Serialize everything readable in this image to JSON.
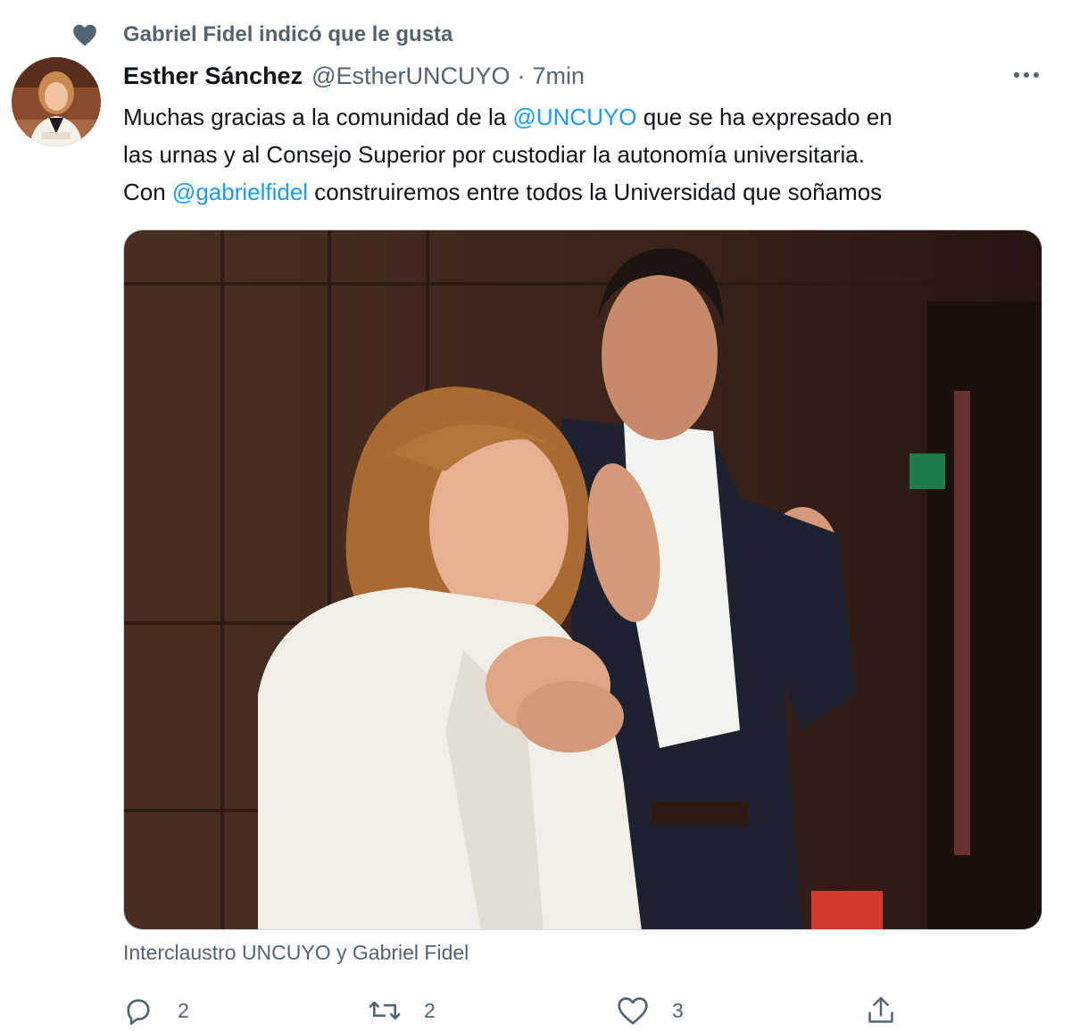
{
  "social_context": {
    "icon": "heart-icon",
    "text": "Gabriel Fidel indicó que le gusta"
  },
  "author": {
    "name": "Esther Sánchez",
    "handle": "@EstherUNCUYO",
    "separator": "·",
    "time": "7min"
  },
  "tweet": {
    "line1_pre": "Muchas gracias a la comunidad de la ",
    "mention1": "@UNCUYO",
    "line1_post": " que se ha expresado en",
    "line2": "las urnas y al Consejo Superior por custodiar la autonomía universitaria.",
    "line3_pre": "Con ",
    "mention2": "@gabrielfidel",
    "line3_post": " construiremos entre todos la Universidad que soñamos"
  },
  "media": {
    "caption": "Interclaustro UNCUYO y Gabriel Fidel"
  },
  "actions": {
    "reply_count": "2",
    "retweet_count": "2",
    "like_count": "3"
  },
  "colors": {
    "text": "#0f1419",
    "secondary": "#536471",
    "link": "#1d9bf0"
  }
}
